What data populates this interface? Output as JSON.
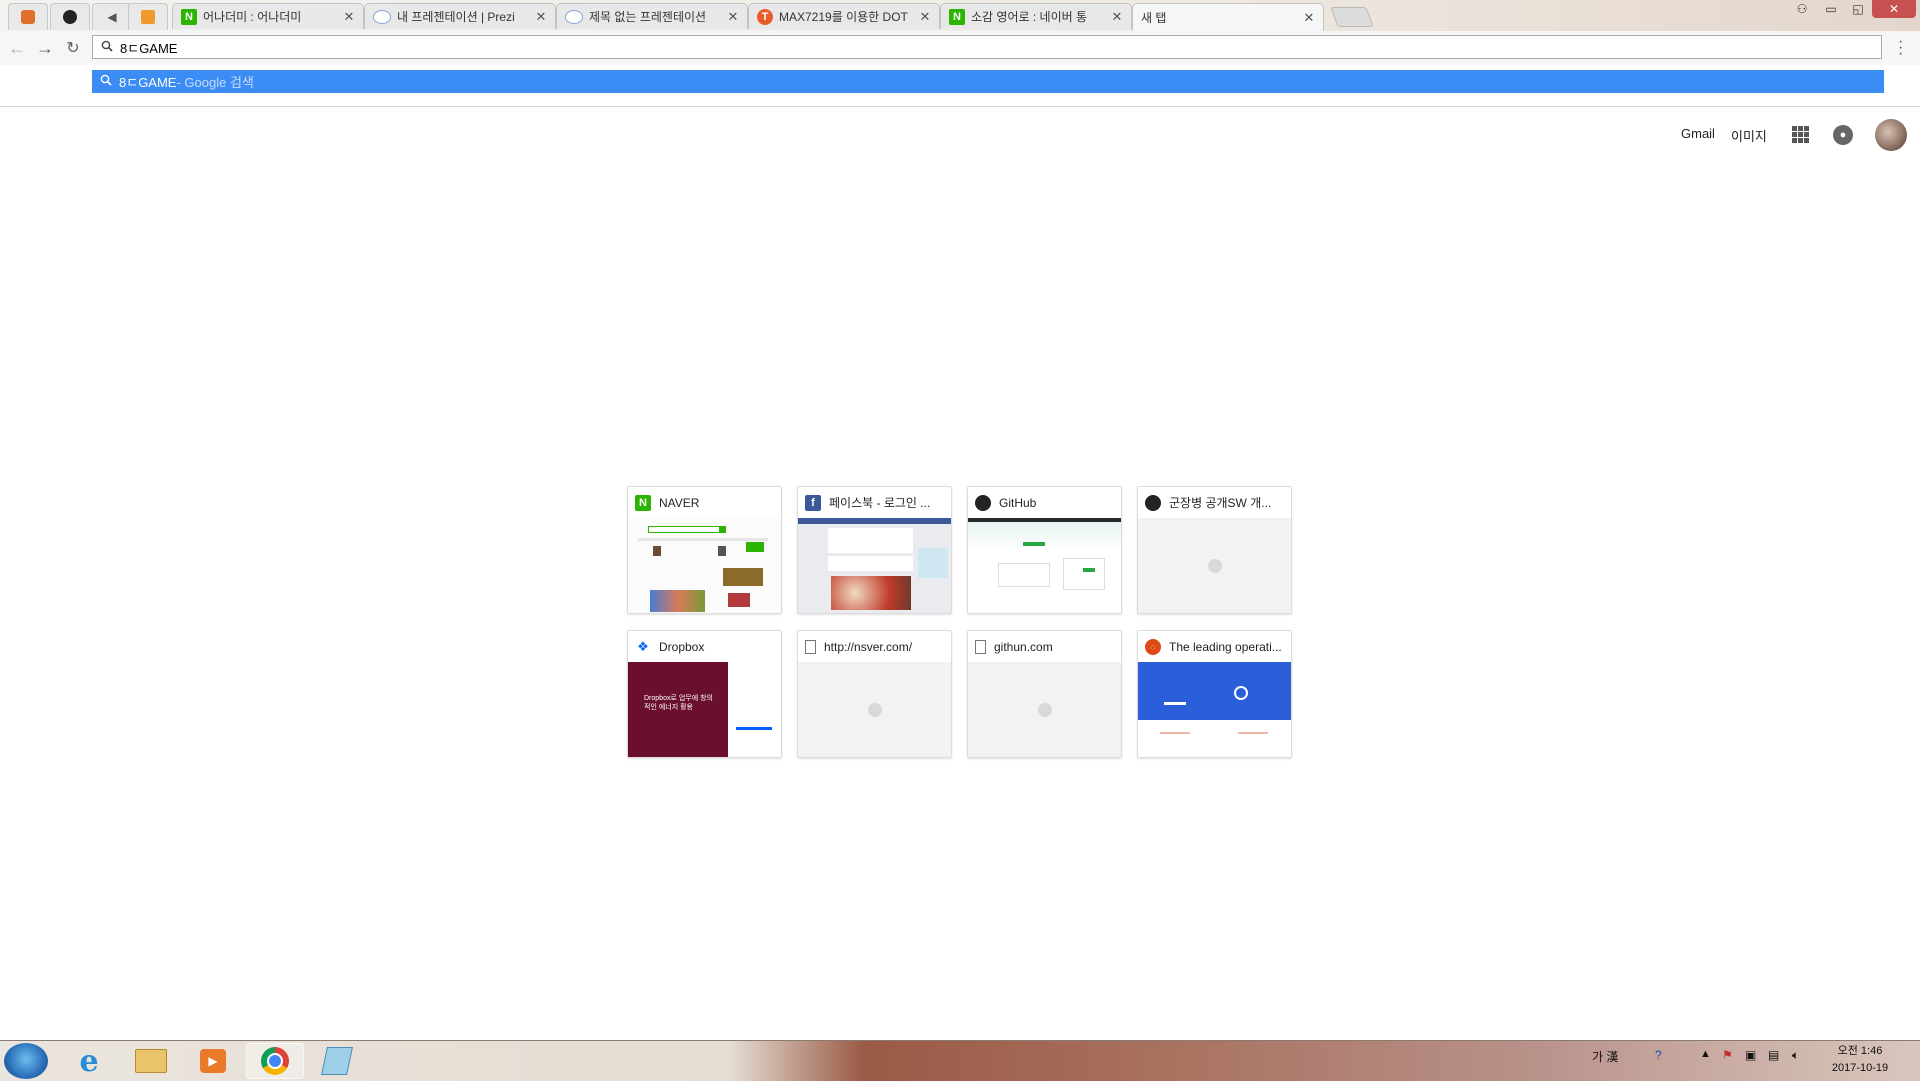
{
  "browser": {
    "pinned_tabs": [
      {
        "icon": "fox-icon"
      },
      {
        "icon": "github-icon"
      },
      {
        "icon": "speaker-icon"
      },
      {
        "icon": "orange-square-icon"
      }
    ],
    "tabs": [
      {
        "title": "어나더미 : 어나더미",
        "icon": "naver-icon",
        "icon_color": "#2db400",
        "icon_glyph": "N"
      },
      {
        "title": "내 프레젠테이션 | Prezi",
        "icon": "globe-icon",
        "icon_color": "#8aa6d8",
        "icon_glyph": ""
      },
      {
        "title": "제목 없는 프레젠테이션",
        "icon": "globe-icon",
        "icon_color": "#8aa6d8",
        "icon_glyph": ""
      },
      {
        "title": "MAX7219를 이용한 DOT",
        "icon": "tistory-icon",
        "icon_color": "#eb5a2b",
        "icon_glyph": "T"
      },
      {
        "title": "소감 영어로 : 네이버 통",
        "icon": "naver-icon",
        "icon_color": "#2db400",
        "icon_glyph": "N"
      },
      {
        "title": "새 탭",
        "icon": "",
        "icon_color": "",
        "icon_glyph": "",
        "active": true
      }
    ],
    "omnibox": {
      "value": "8ㄷGAME"
    },
    "suggestion": {
      "query": "8ㄷGAME",
      "hint": " - Google 검색"
    }
  },
  "ntp": {
    "gmail_label": "Gmail",
    "images_label": "이미지",
    "tiles": [
      {
        "title": "NAVER",
        "icon": "naver-icon",
        "icon_color": "#2db400",
        "icon_glyph": "N",
        "thumb": "naver"
      },
      {
        "title": "페이스북 - 로그인 ...",
        "icon": "facebook-icon",
        "icon_color": "#3b5998",
        "icon_glyph": "f",
        "thumb": "facebook"
      },
      {
        "title": "GitHub",
        "icon": "github-icon",
        "icon_color": "#222222",
        "icon_glyph": "",
        "thumb": "github"
      },
      {
        "title": "군장병 공개SW 개...",
        "icon": "github-icon",
        "icon_color": "#222222",
        "icon_glyph": "",
        "thumb": "blank"
      },
      {
        "title": "Dropbox",
        "icon": "dropbox-icon",
        "icon_color": "#0061fe",
        "icon_glyph": "",
        "thumb": "dropbox"
      },
      {
        "title": "http://nsver.com/",
        "icon": "page-icon",
        "icon_color": "#777777",
        "icon_glyph": "",
        "thumb": "blank"
      },
      {
        "title": "githun.com",
        "icon": "page-icon",
        "icon_color": "#777777",
        "icon_glyph": "",
        "thumb": "blank"
      },
      {
        "title": "The leading operati...",
        "icon": "ubuntu-icon",
        "icon_color": "#dd4814",
        "icon_glyph": "",
        "thumb": "ubuntu"
      }
    ],
    "dropbox_thumb_text": "Dropbox로 업무에 창의적인 에너지 활용"
  },
  "taskbar": {
    "apps": [
      {
        "name": "ie-icon"
      },
      {
        "name": "explorer-icon"
      },
      {
        "name": "media-player-icon"
      },
      {
        "name": "chrome-icon",
        "active": true
      },
      {
        "name": "notepad-icon"
      }
    ],
    "ime_label": "가 漢",
    "clock_time": "오전 1:46",
    "clock_date": "2017-10-19"
  },
  "colors": {
    "suggestion_bg": "#3b8cf4",
    "naver_green": "#2db400",
    "dropbox_maroon": "#6b0f2e",
    "ubuntu_blue": "#2b5fd9"
  }
}
